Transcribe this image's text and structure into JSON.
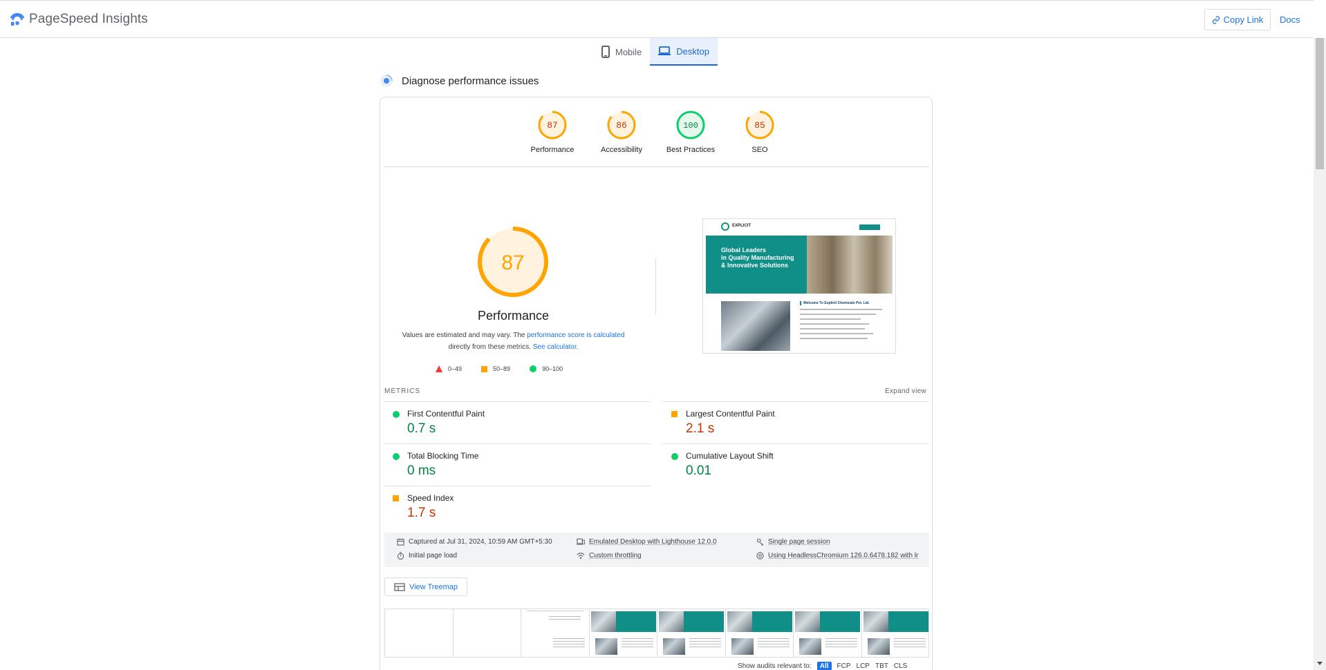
{
  "header": {
    "app_title": "PageSpeed Insights",
    "copy_link": "Copy Link",
    "docs": "Docs"
  },
  "tabs": [
    {
      "label": "Mobile",
      "active": false
    },
    {
      "label": "Desktop",
      "active": true
    }
  ],
  "diagnose": {
    "title": "Diagnose performance issues"
  },
  "scores": [
    {
      "label": "Performance",
      "score": "87",
      "color": "#ffa400"
    },
    {
      "label": "Accessibility",
      "score": "86",
      "color": "#ffa400"
    },
    {
      "label": "Best Practices",
      "score": "100",
      "color": "#0cce6b"
    },
    {
      "label": "SEO",
      "score": "85",
      "color": "#ffa400"
    }
  ],
  "main_score": {
    "score": "87",
    "title": "Performance",
    "desc_prefix": "Values are estimated and may vary. The ",
    "desc_link": "performance score is calculated",
    "desc_mid": "directly from these metrics. ",
    "desc_calc": "See calculator."
  },
  "legend": [
    {
      "range": "0–49",
      "color": "#ff3333"
    },
    {
      "range": "50–89",
      "color": "#ffa400"
    },
    {
      "range": "90–100",
      "color": "#0cce6b"
    }
  ],
  "screenshot": {
    "brand": "EXPLICIT",
    "hero_line1": "Global Leaders",
    "hero_line2": "in Quality Manufacturing",
    "hero_line3": "& Innovative Solutions",
    "welcome": "Welcome To Explicit Chemicals Pvt. Ltd."
  },
  "metrics": {
    "heading": "METRICS",
    "expand": "Expand view",
    "items": [
      {
        "name": "First Contentful Paint",
        "value": "0.7 s",
        "status": "good"
      },
      {
        "name": "Largest Contentful Paint",
        "value": "2.1 s",
        "status": "average"
      },
      {
        "name": "Total Blocking Time",
        "value": "0 ms",
        "status": "good"
      },
      {
        "name": "Cumulative Layout Shift",
        "value": "0.01",
        "status": "good"
      },
      {
        "name": "Speed Index",
        "value": "1.7 s",
        "status": "average"
      }
    ]
  },
  "info": {
    "captured": "Captured at Jul 31, 2024, 10:59 AM GMT+5:30",
    "initial_load": "Initial page load",
    "emulated": "Emulated Desktop with Lighthouse 12.0.0",
    "throttling": "Custom throttling",
    "session": "Single page session",
    "browser": "Using HeadlessChromium 126.0.6478.182 with lr"
  },
  "treemap": {
    "label": "View Treemap"
  },
  "relevant": {
    "label": "Show audits relevant to:",
    "filters": [
      "All",
      "FCP",
      "LCP",
      "TBT",
      "CLS"
    ]
  }
}
